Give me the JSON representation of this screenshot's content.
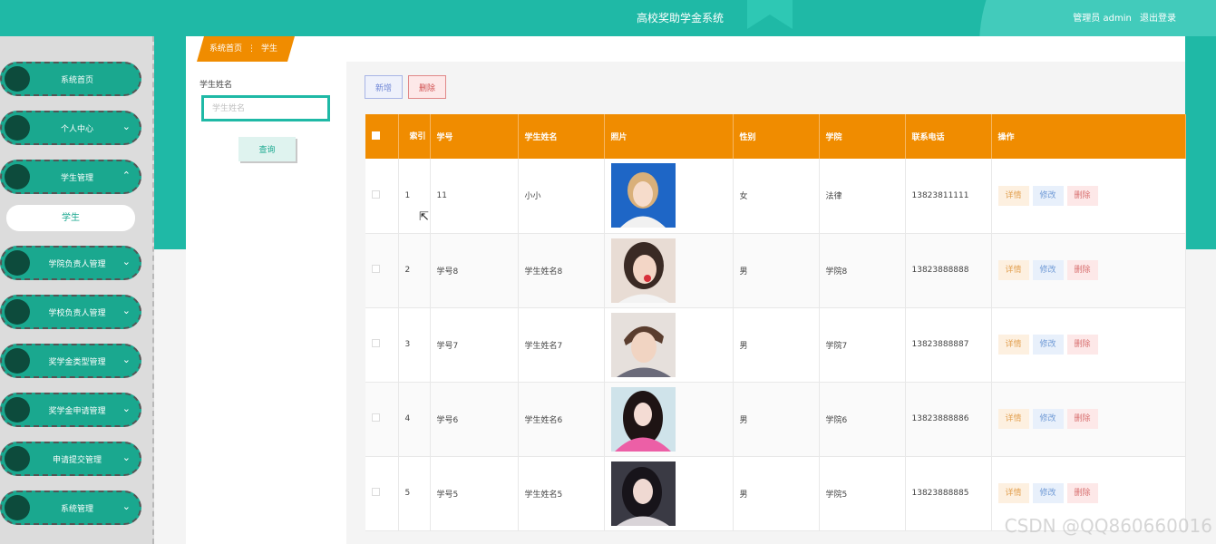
{
  "header": {
    "title": "高校奖助学金系统",
    "user_label": "管理员 admin",
    "logout_label": "退出登录"
  },
  "sidebar": {
    "items": [
      {
        "label": "系统首页",
        "chevron": ""
      },
      {
        "label": "个人中心",
        "chevron": "⌄"
      },
      {
        "label": "学生管理",
        "chevron": "⌃"
      },
      {
        "label": "学院负责人管理",
        "chevron": "⌄"
      },
      {
        "label": "学校负责人管理",
        "chevron": "⌄"
      },
      {
        "label": "奖学金类型管理",
        "chevron": "⌄"
      },
      {
        "label": "奖学金申请管理",
        "chevron": "⌄"
      },
      {
        "label": "申请提交管理",
        "chevron": "⌄"
      },
      {
        "label": "系统管理",
        "chevron": "⌄"
      }
    ],
    "active_sub": "学生"
  },
  "breadcrumb": {
    "home": "系统首页",
    "sep": "⋮",
    "current": "学生"
  },
  "search": {
    "label": "学生姓名",
    "placeholder": "学生姓名",
    "button": "查询"
  },
  "toolbar": {
    "add_label": "新增",
    "delete_label": "删除"
  },
  "table": {
    "headers": [
      "索引",
      "学号",
      "学生姓名",
      "照片",
      "性别",
      "学院",
      "联系电话",
      "操作"
    ],
    "actions": {
      "detail": "详情",
      "edit": "修改",
      "remove": "删除"
    },
    "rows": [
      {
        "index": "1",
        "student_id": "11",
        "name": "小小",
        "gender": "女",
        "college": "法律",
        "phone": "13823811111"
      },
      {
        "index": "2",
        "student_id": "学号8",
        "name": "学生姓名8",
        "gender": "男",
        "college": "学院8",
        "phone": "13823888888"
      },
      {
        "index": "3",
        "student_id": "学号7",
        "name": "学生姓名7",
        "gender": "男",
        "college": "学院7",
        "phone": "13823888887"
      },
      {
        "index": "4",
        "student_id": "学号6",
        "name": "学生姓名6",
        "gender": "男",
        "college": "学院6",
        "phone": "13823888886"
      },
      {
        "index": "5",
        "student_id": "学号5",
        "name": "学生姓名5",
        "gender": "男",
        "college": "学院5",
        "phone": "13823888885"
      }
    ]
  },
  "watermark": "CSDN @QQ860660016",
  "colors": {
    "primary": "#1fb9a6",
    "table_header": "#f08c00",
    "sidebar_item": "#1aa88f"
  }
}
